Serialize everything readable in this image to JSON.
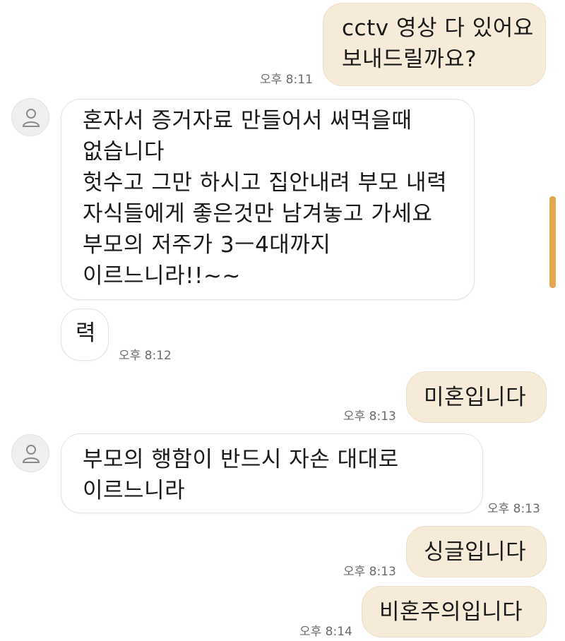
{
  "chat": {
    "messages": [
      {
        "id": "m1",
        "direction": "out",
        "text": "cctv 영상 다 있어요\n보내드릴까요?",
        "time": "오후 8:11"
      },
      {
        "id": "m2",
        "direction": "in",
        "text": "혼자서 증거자료 만들어서 써먹을때\n없습니다\n헛수고 그만 하시고 집안내려 부모 내력\n자식들에게 좋은것만 남겨놓고 가세요\n부모의 저주가 3ㅡ4대까지\n이르느니라!!~~",
        "time": ""
      },
      {
        "id": "m3",
        "direction": "in",
        "text": "력",
        "time": "오후 8:12"
      },
      {
        "id": "m4",
        "direction": "out",
        "text": "미혼입니다",
        "time": "오후 8:13"
      },
      {
        "id": "m5",
        "direction": "in",
        "text": "부모의 행함이 반드시 자손 대대로\n이르느니라",
        "time": "오후 8:13"
      },
      {
        "id": "m6",
        "direction": "out",
        "text": "싱글입니다",
        "time": "오후 8:13"
      },
      {
        "id": "m7",
        "direction": "out",
        "text": "비혼주의입니다",
        "time": "오후 8:14"
      }
    ],
    "avatar_icon": "user-silhouette-icon",
    "colors": {
      "outgoing_bubble": "#f6ead8",
      "incoming_bubble": "#ffffff",
      "scrollbar": "#e3a84f"
    }
  }
}
